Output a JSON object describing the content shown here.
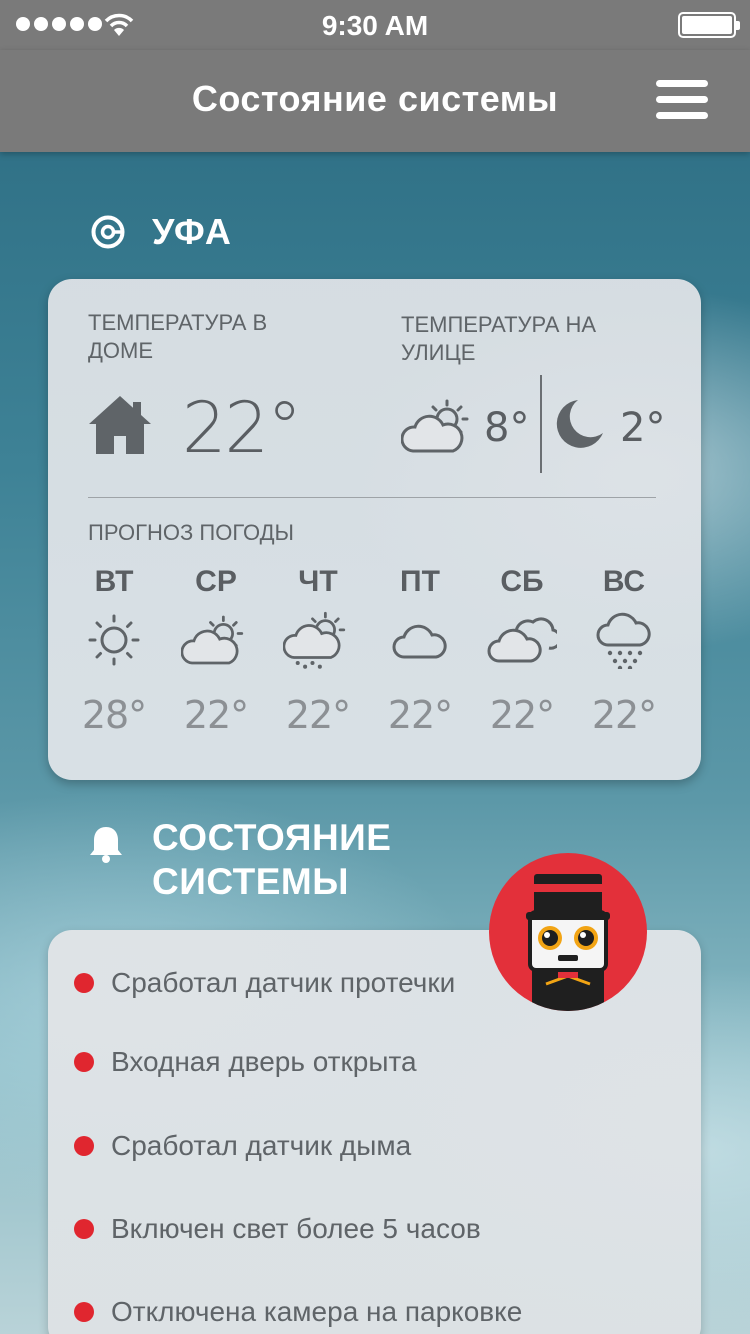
{
  "status_bar": {
    "time": "9:30 AM"
  },
  "header": {
    "title": "Состояние системы"
  },
  "city": {
    "name": "УФА"
  },
  "weather": {
    "indoor_label": "ТЕМПЕРАТУРА В ДОМЕ",
    "indoor_temp": "22°",
    "outdoor_label": "ТЕМПЕРАТУРА НА УЛИЦЕ",
    "outdoor_day_temp": "8°",
    "outdoor_night_temp": "2°",
    "forecast_label": "ПРОГНОЗ ПОГОДЫ",
    "forecast": [
      {
        "day": "ВТ",
        "temp": "28°",
        "icon": "sun-icon"
      },
      {
        "day": "СР",
        "temp": "22°",
        "icon": "partly-cloudy-icon"
      },
      {
        "day": "ЧТ",
        "temp": "22°",
        "icon": "partly-cloudy-rain-icon"
      },
      {
        "day": "ПТ",
        "temp": "22°",
        "icon": "cloud-icon"
      },
      {
        "day": "СБ",
        "temp": "22°",
        "icon": "clouds-icon"
      },
      {
        "day": "ВС",
        "temp": "22°",
        "icon": "rain-cloud-icon"
      }
    ]
  },
  "system": {
    "title": "СОСТОЯНИЕ СИСТЕМЫ",
    "alerts": [
      "Сработал датчик протечки",
      "Входная дверь открыта",
      "Сработал датчик дыма",
      "Включен свет более 5 часов",
      "Отключена камера на парковке"
    ]
  },
  "colors": {
    "alert_dot": "#e0262f",
    "bar": "#7a7a7a",
    "mascot_bg": "#e3303a"
  }
}
